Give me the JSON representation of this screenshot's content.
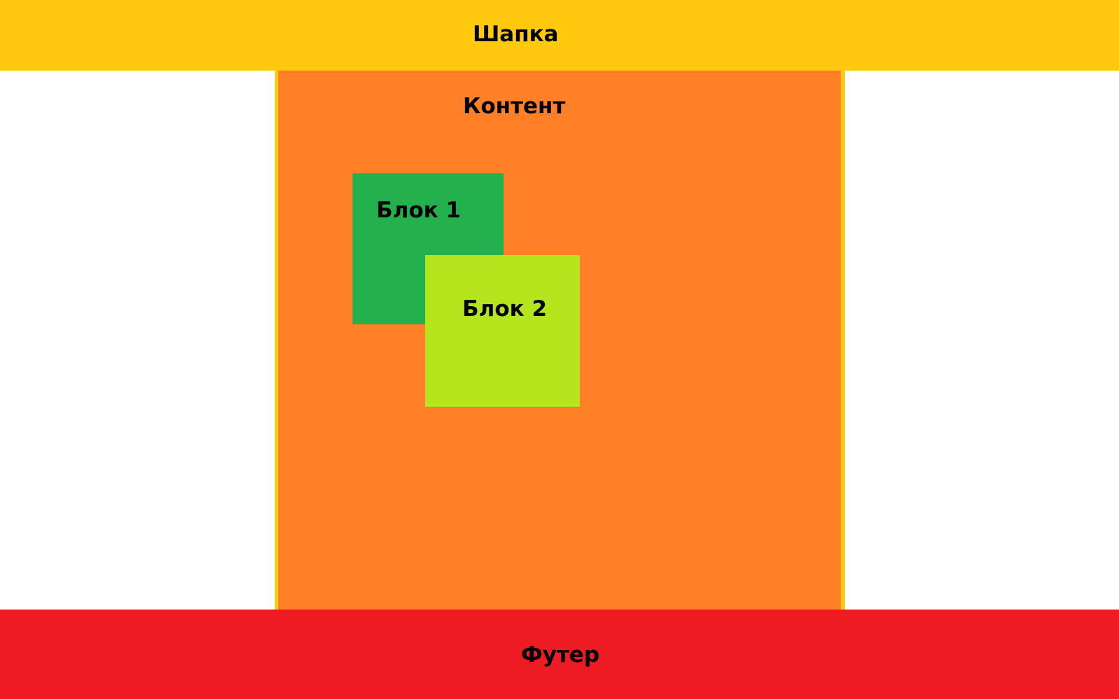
{
  "header": {
    "title": "Шапка"
  },
  "content": {
    "title": "Контент"
  },
  "blocks": [
    {
      "label": "Блок 1"
    },
    {
      "label": "Блок 2"
    }
  ],
  "footer": {
    "title": "Футер"
  },
  "colors": {
    "header": "#FFC90E",
    "content": "#FF7F27",
    "content_border": "#FFC90E",
    "block1": "#22B14C",
    "block2": "#B5E61D",
    "footer": "#ED1C24",
    "background": "#FFFFFF",
    "text": "#000000"
  }
}
